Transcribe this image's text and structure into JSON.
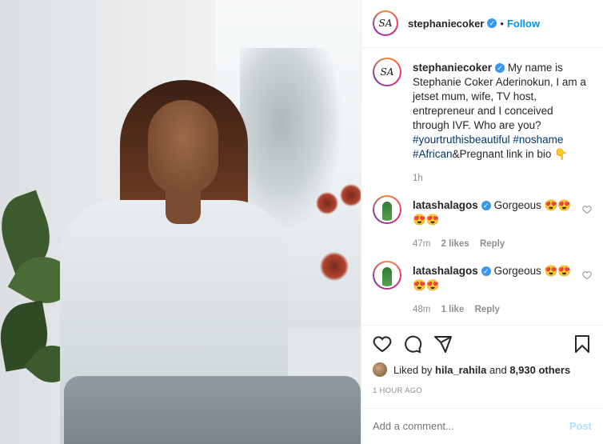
{
  "post": {
    "author": {
      "username": "stephaniecoker",
      "avatar_initials": "SA",
      "verified": true
    },
    "follow_label": "Follow",
    "separator": "•",
    "caption": {
      "username": "stephaniecoker",
      "text": "My name is Stephanie Coker Aderinokun, I am a jetset mum, wife, TV host, entrepreneur and I conceived through IVF. Who are you?",
      "hashtags": [
        "#yourtruthisbeautiful",
        "#noshame",
        "#African"
      ],
      "after_tags": "&Pregnant link in bio 👇",
      "time": "1h"
    },
    "comments": [
      {
        "username": "latashalagos",
        "text": "Gorgeous 😍😍😍😍",
        "time": "47m",
        "likes": "2 likes",
        "reply": "Reply"
      },
      {
        "username": "latashalagos",
        "text": "Gorgeous 😍😍😍😍",
        "time": "48m",
        "likes": "1 like",
        "reply": "Reply"
      }
    ],
    "liked_by_prefix": "Liked by",
    "liked_by_user": "hila_rahila",
    "liked_by_middle": "and",
    "liked_by_count": "8,930 others",
    "timestamp": "1 HOUR AGO",
    "add_comment_placeholder": "Add a comment...",
    "post_button": "Post"
  }
}
